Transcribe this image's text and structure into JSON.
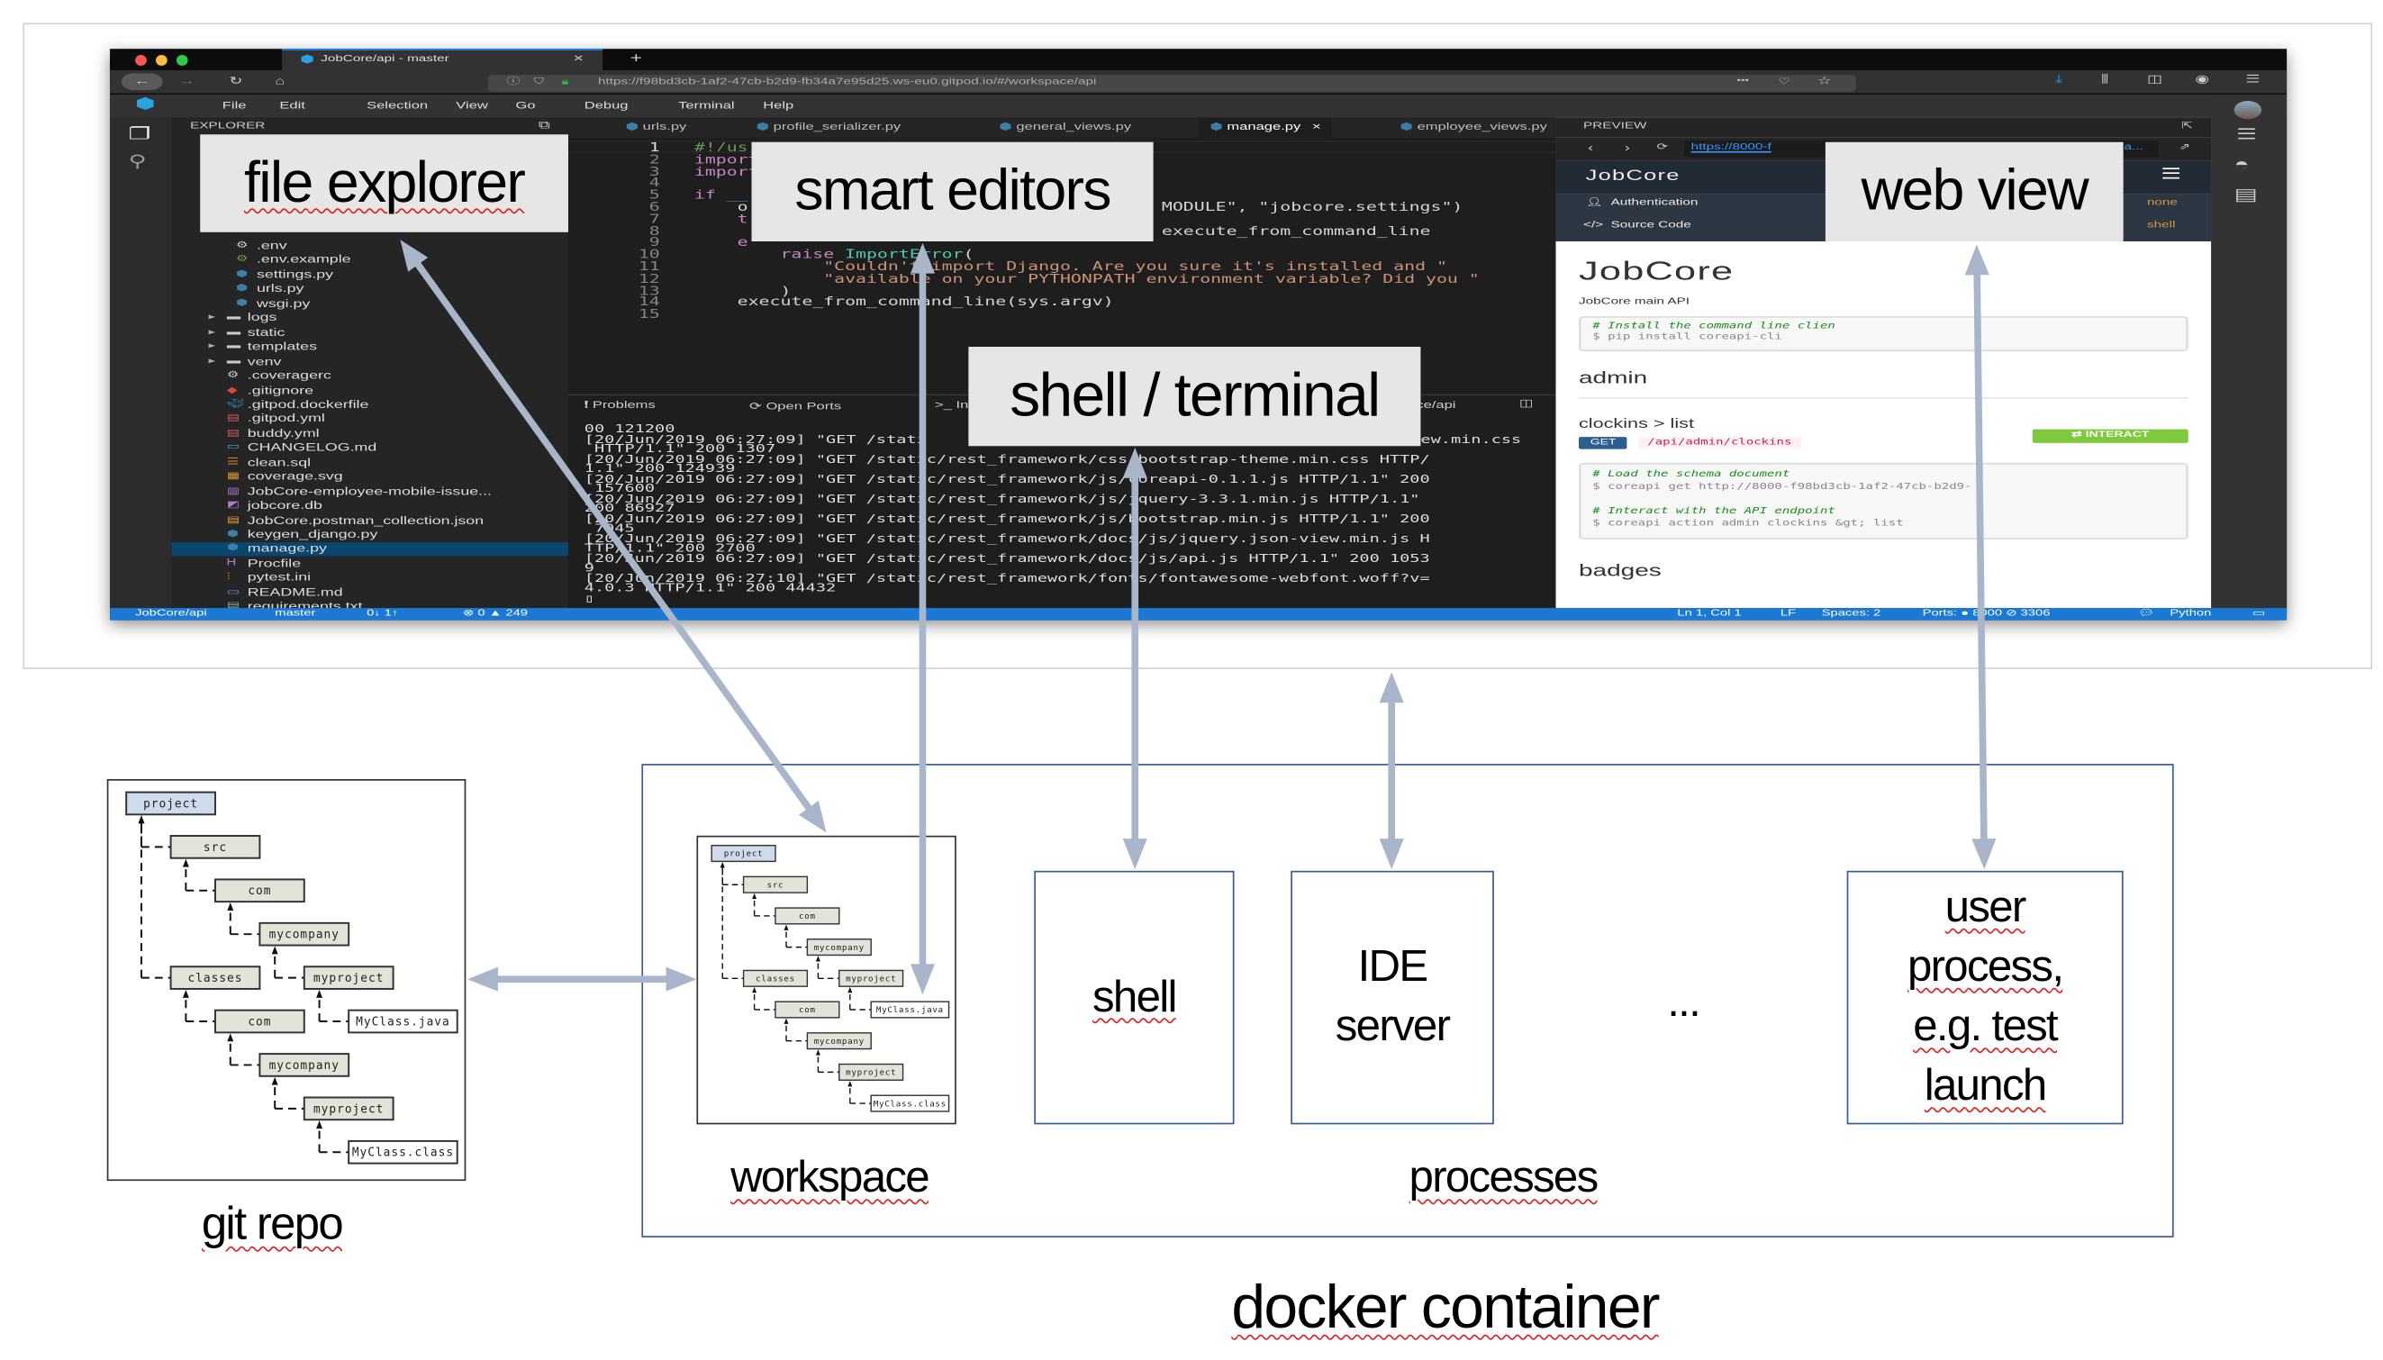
{
  "browser": {
    "tab_title": "JobCore/api - master",
    "close": "✕",
    "new_tab": "+",
    "url": "https://f98bd3cb-1af2-47cb-b2d9-fb34a7e95d25.ws-eu0.gitpod.io/#/workspace/api",
    "more": "•••"
  },
  "menu": [
    "File",
    "Edit",
    "Selection",
    "View",
    "Go",
    "Debug",
    "Terminal",
    "Help"
  ],
  "explorer": {
    "title": "EXPLORER",
    "items": [
      {
        "label": ".env",
        "kind": "gear",
        "level": 1
      },
      {
        "label": ".env.example",
        "kind": "gear-green",
        "level": 1
      },
      {
        "label": "settings.py",
        "kind": "python",
        "level": 1
      },
      {
        "label": "urls.py",
        "kind": "python",
        "level": 1
      },
      {
        "label": "wsgi.py",
        "kind": "python",
        "level": 1
      },
      {
        "label": "logs",
        "kind": "folder",
        "level": 0
      },
      {
        "label": "static",
        "kind": "folder",
        "level": 0
      },
      {
        "label": "templates",
        "kind": "folder",
        "level": 0
      },
      {
        "label": "venv",
        "kind": "folder",
        "level": 0
      },
      {
        "label": ".coveragerc",
        "kind": "gear",
        "level": 0
      },
      {
        "label": ".gitignore",
        "kind": "git",
        "level": 0
      },
      {
        "label": ".gitpod.dockerfile",
        "kind": "docker",
        "level": 0
      },
      {
        "label": ".gitpod.yml",
        "kind": "yml",
        "level": 0
      },
      {
        "label": "buddy.yml",
        "kind": "yml",
        "level": 0
      },
      {
        "label": "CHANGELOG.md",
        "kind": "md",
        "level": 0
      },
      {
        "label": "clean.sql",
        "kind": "sql",
        "level": 0
      },
      {
        "label": "coverage.svg",
        "kind": "svg",
        "level": 0
      },
      {
        "label": "JobCore-employee-mobile-issue...",
        "kind": "chart",
        "level": 0
      },
      {
        "label": "jobcore.db",
        "kind": "db",
        "level": 0
      },
      {
        "label": "JobCore.postman_collection.json",
        "kind": "json",
        "level": 0
      },
      {
        "label": "keygen_django.py",
        "kind": "python",
        "level": 0
      },
      {
        "label": "manage.py",
        "kind": "python",
        "level": 0,
        "selected": true
      },
      {
        "label": "Procfile",
        "kind": "procfile",
        "level": 0
      },
      {
        "label": "pytest.ini",
        "kind": "ini",
        "level": 0
      },
      {
        "label": "README.md",
        "kind": "md",
        "level": 0
      },
      {
        "label": "requirements.txt",
        "kind": "txt",
        "level": 0
      }
    ]
  },
  "editor": {
    "tabs": [
      "urls.py",
      "profile_serializer.py",
      "general_views.py",
      "manage.py",
      "employee_views.py"
    ],
    "active_tab": 3,
    "tab_close": "×",
    "lines": [
      {
        "n": "1",
        "segs": [
          {
            "t": "#!/us",
            "c": "#6a9955"
          }
        ]
      },
      {
        "n": "2",
        "segs": [
          {
            "t": "import",
            "c": "#c586c0"
          }
        ]
      },
      {
        "n": "3",
        "segs": [
          {
            "t": "import",
            "c": "#c586c0"
          }
        ]
      },
      {
        "n": "4",
        "segs": []
      },
      {
        "n": "5",
        "segs": [
          {
            "t": "if ",
            "c": "#c586c0"
          },
          {
            "t": "__",
            "c": "#569cd6"
          }
        ]
      },
      {
        "n": "6",
        "segs": [
          {
            "t": "    o",
            "c": "#d4d4d4"
          }
        ],
        "right": [
          {
            "t": "MODULE\", \"jobcore.settings\")",
            "c": "#d4d4d4"
          }
        ]
      },
      {
        "n": "7",
        "segs": [
          {
            "t": "    t",
            "c": "#c586c0"
          }
        ]
      },
      {
        "n": "8",
        "segs": [],
        "right": [
          {
            "t": "execute_from_command_line",
            "c": "#d4d4d4"
          }
        ]
      },
      {
        "n": "9",
        "segs": [
          {
            "t": "    e",
            "c": "#c586c0"
          }
        ]
      },
      {
        "n": "10",
        "segs": [
          {
            "t": "        raise ",
            "c": "#c586c0"
          },
          {
            "t": "ImportError",
            "c": "#4ec9b0"
          },
          {
            "t": "(",
            "c": "#d4d4d4"
          }
        ]
      },
      {
        "n": "11",
        "segs": [
          {
            "t": "            \"Couldn't import Django. Are you sure it's installed and \"",
            "c": "#ce9178"
          }
        ]
      },
      {
        "n": "12",
        "segs": [
          {
            "t": "            \"available on your PYTHONPATH environment variable? Did you \"",
            "c": "#ce9178"
          }
        ]
      },
      {
        "n": "13",
        "segs": [
          {
            "t": "        )",
            "c": "#d4d4d4"
          }
        ]
      },
      {
        "n": "14",
        "segs": [
          {
            "t": "    execute_from_command_line(sys.argv)",
            "c": "#d4d4d4"
          }
        ]
      },
      {
        "n": "15",
        "segs": []
      }
    ]
  },
  "panel": {
    "tabs": [
      "Problems",
      "Open Ports",
      ">_ In",
      "ce/api"
    ],
    "terminal": [
      {
        "t": "00 121200"
      },
      {
        "t": "[20/Jun/2019 06:27:09] \"GET /stati",
        "right": "ew.min.css"
      },
      {
        "t": " HTTP/1.1\" 200 1307"
      },
      {
        "t": "[20/Jun/2019 06:27:09] \"GET /static/rest_framework/css/bootstrap-theme.min.css HTTP/"
      },
      {
        "t": "1.1\" 200 124939"
      },
      {
        "t": "[20/Jun/2019 06:27:09] \"GET /static/rest_framework/js/coreapi-0.1.1.js HTTP/1.1\" 200"
      },
      {
        "t": " 157600"
      },
      {
        "t": "[20/Jun/2019 06:27:09] \"GET /static/rest_framework/js/jquery-3.3.1.min.js HTTP/1.1\""
      },
      {
        "t": "200 86927"
      },
      {
        "t": "[20/Jun/2019 06:27:09] \"GET /static/rest_framework/js/bootstrap.min.js HTTP/1.1\" 200"
      },
      {
        "t": " 7045"
      },
      {
        "t": "[20/Jun/2019 06:27:09] \"GET /static/rest_framework/docs/js/jquery.json-view.min.js H"
      },
      {
        "t": "TTP/1.1\" 200 2700"
      },
      {
        "t": "[20/Jun/2019 06:27:09] \"GET /static/rest_framework/docs/js/api.js HTTP/1.1\" 200 1053"
      },
      {
        "t": "9"
      },
      {
        "t": "[20/Jun/2019 06:27:10] \"GET /static/rest_framework/fonts/fontawesome-webfont.woff?v="
      },
      {
        "t": "4.0.3 HTTP/1.1\" 200 44432"
      },
      {
        "t": "▯"
      }
    ]
  },
  "preview": {
    "title": "PREVIEW",
    "url": "https://8000-f",
    "url_tail": "a...",
    "brand": "JobCore",
    "nav": [
      {
        "label": "Authentication",
        "right": "none"
      },
      {
        "label": "Source Code",
        "right": "shell"
      }
    ],
    "page_title": "JobCore",
    "subtitle": "JobCore main API",
    "install_comment": "# Install the command line clien",
    "install_cmd": "$ pip install coreapi-cli",
    "section": "admin",
    "endpoint_title": "clockins > list",
    "method": "GET",
    "path": "/api/admin/clockins",
    "interact": "⇄ INTERACT",
    "code": [
      "# Load the schema document",
      "$ coreapi get http://8000-f98bd3cb-1af2-47cb-b2d9-",
      "",
      "# Interact with the API endpoint",
      "$ coreapi action admin clockins &gt; list"
    ],
    "next_section": "badges"
  },
  "status": {
    "repo": "JobCore/api",
    "branch": "master",
    "sync": "0↓ 1↑",
    "problems": "⊗ 0 ▲ 249",
    "position": "Ln 1, Col 1",
    "eol": "LF",
    "spaces": "Spaces: 2",
    "ports": "Ports: ● 8000 ⊘ 3306",
    "language": "Python"
  },
  "labels": {
    "file_explorer": "file explorer",
    "smart_editors": "smart editors",
    "shell_terminal": "shell / terminal",
    "web_view": "web view"
  },
  "tree": {
    "nodes": [
      {
        "label": "project",
        "row": 0,
        "level": 0,
        "kind": "root",
        "parent": null
      },
      {
        "label": "src",
        "row": 1,
        "level": 1,
        "kind": "dir",
        "parent": 0
      },
      {
        "label": "com",
        "row": 2,
        "level": 2,
        "kind": "dir",
        "parent": 1
      },
      {
        "label": "mycompany",
        "row": 3,
        "level": 3,
        "kind": "dir",
        "parent": 2
      },
      {
        "label": "classes",
        "row": 4,
        "level": 1,
        "kind": "dir",
        "parent": 0
      },
      {
        "label": "myproject",
        "row": 4,
        "level": 4,
        "kind": "dir",
        "parent": 3
      },
      {
        "label": "com",
        "row": 5,
        "level": 2,
        "kind": "dir",
        "parent": 4
      },
      {
        "label": "MyClass.java",
        "row": 5,
        "level": 5,
        "kind": "file",
        "parent": 5
      },
      {
        "label": "mycompany",
        "row": 6,
        "level": 3,
        "kind": "dir",
        "parent": 6
      },
      {
        "label": "myproject",
        "row": 7,
        "level": 4,
        "kind": "dir",
        "parent": 8
      },
      {
        "label": "MyClass.class",
        "row": 8,
        "level": 5,
        "kind": "file",
        "parent": 9
      }
    ]
  },
  "diagram": {
    "git_repo": "git repo",
    "workspace": "workspace",
    "processes": "processes",
    "docker_container": "docker container",
    "shell": "shell",
    "ide_server": "IDE server",
    "ellipsis": "...",
    "user_process": "user process, e.g. test launch"
  },
  "colors": {
    "arrow": "#a9b6ca",
    "box_border": "#3a5a9a",
    "status_bar": "#1a79d4",
    "tree_dir": "#e3e3da",
    "tree_root": "#cddbec"
  }
}
